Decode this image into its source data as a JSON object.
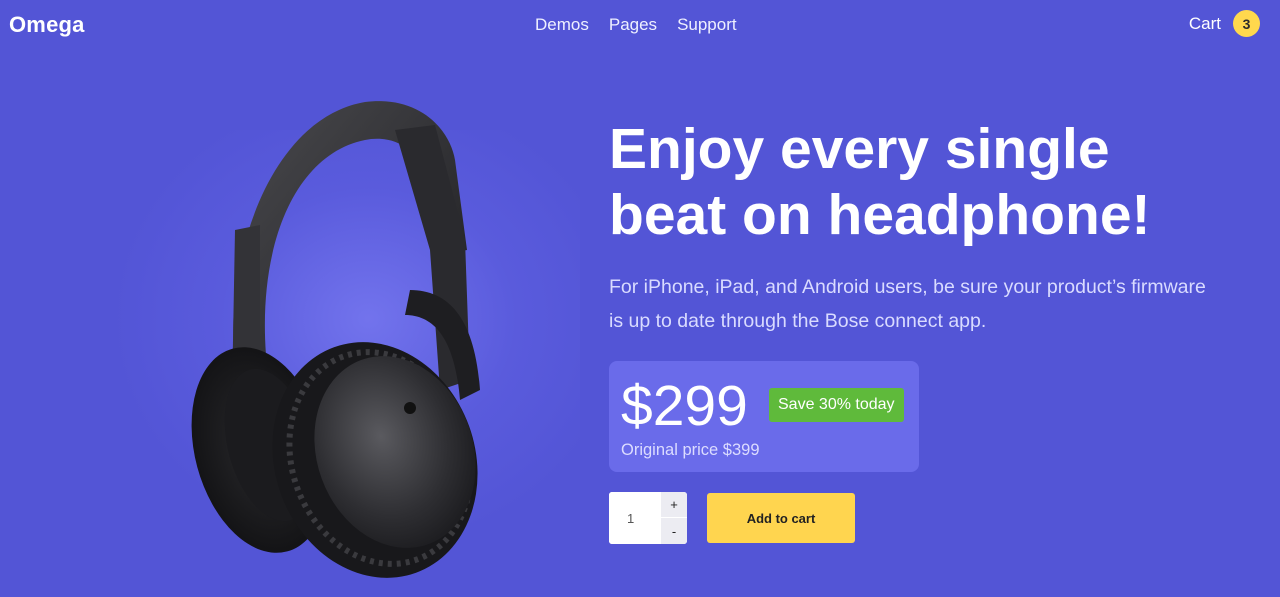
{
  "brand": "Omega",
  "nav": [
    {
      "label": "Demos"
    },
    {
      "label": "Pages"
    },
    {
      "label": "Support"
    }
  ],
  "cart": {
    "label": "Cart",
    "count": "3"
  },
  "hero": {
    "headline_line1": "Enjoy every single",
    "headline_line2": "beat on headphone!",
    "description": "For iPhone, iPad, and Android users, be sure your product’s firmware is up to date through the Bose connect app."
  },
  "pricing": {
    "price": "$299",
    "save_badge": "Save 30% today",
    "original": "Original price $399"
  },
  "quantity": {
    "value": "1",
    "plus": "+",
    "minus": "-"
  },
  "add_to_cart": "Add to cart",
  "colors": {
    "background": "#5355d6",
    "price_card": "#6a6bea",
    "save_badge": "#5fba3b",
    "accent_yellow": "#ffd54f"
  },
  "product_image": "headphones-image"
}
